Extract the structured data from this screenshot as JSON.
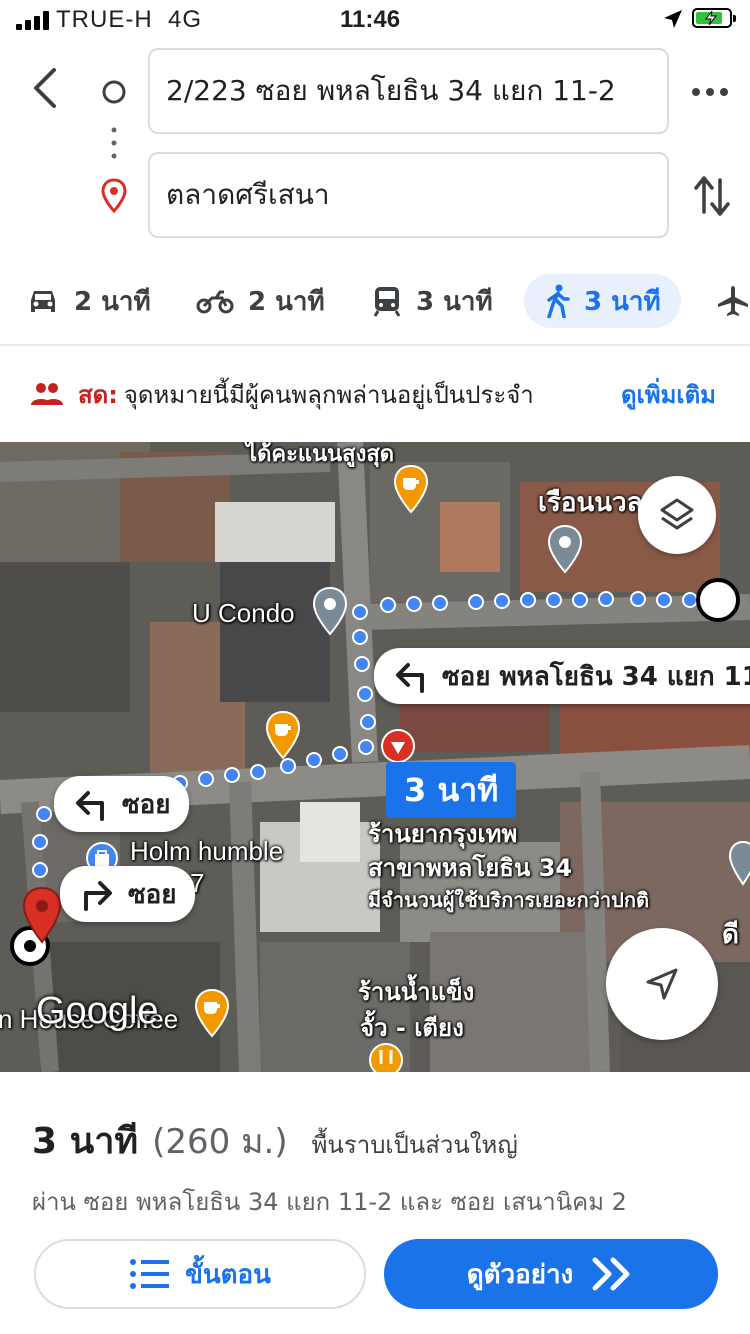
{
  "status_bar": {
    "carrier": "TRUE-H",
    "network": "4G",
    "time": "11:46"
  },
  "directions": {
    "origin": "2/223 ซอย พหลโยธิน 34 แยก 11-2",
    "destination": "ตลาดศรีเสนา"
  },
  "modes": [
    {
      "icon": "car-icon",
      "label": "2 นาที"
    },
    {
      "icon": "motorcycle-icon",
      "label": "2 นาที"
    },
    {
      "icon": "transit-icon",
      "label": "3 นาที"
    },
    {
      "icon": "walk-icon",
      "label": "3 นาที",
      "active": true
    },
    {
      "icon": "flight-icon",
      "label": ""
    }
  ],
  "notice": {
    "live_label": "สด:",
    "message": "จุดหมายนี้มีผู้คนพลุกพล่านอยู่เป็นประจำ",
    "more_link": "ดูเพิ่มเติม"
  },
  "map": {
    "labels": {
      "top_cut": "ได้คะแนนสูงสุด",
      "ruean": "เรือนนวล",
      "ucondo": "U Condo",
      "holm": "Holm humble",
      "pharmacy_1": "ร้านยากรุงเทพ",
      "pharmacy_2": "สาขาพหลโยธิน 34",
      "pharmacy_3": "มีจำนวนผู้ใช้บริการเยอะกว่าปกติ",
      "ice_1": "ร้านน้ำแข็ง",
      "ice_2": "จั้ว - เตียง",
      "coffee": "n House Coffee",
      "google": "Google",
      "right_cut": "ดี",
      "number_7": "7"
    },
    "callouts": {
      "turn_main": "ซอย พหลโยธิน 34 แยก 11",
      "turn_left": "ซอย",
      "turn_right": "ซอย",
      "duration": "3 นาที"
    }
  },
  "summary": {
    "duration": "3 นาที",
    "distance": "(260 ม.)",
    "terrain": "พื้นราบเป็นส่วนใหญ่",
    "via": "ผ่าน ซอย พหลโยธิน 34 แยก 11-2 และ ซอย เสนานิคม 2"
  },
  "buttons": {
    "steps": "ขั้นตอน",
    "preview": "ดูตัวอย่าง"
  },
  "colors": {
    "accent": "#1a73e8",
    "live": "#c5221f",
    "route": "#4285f4",
    "pin": "#d93025",
    "cafe": "#f29900"
  }
}
